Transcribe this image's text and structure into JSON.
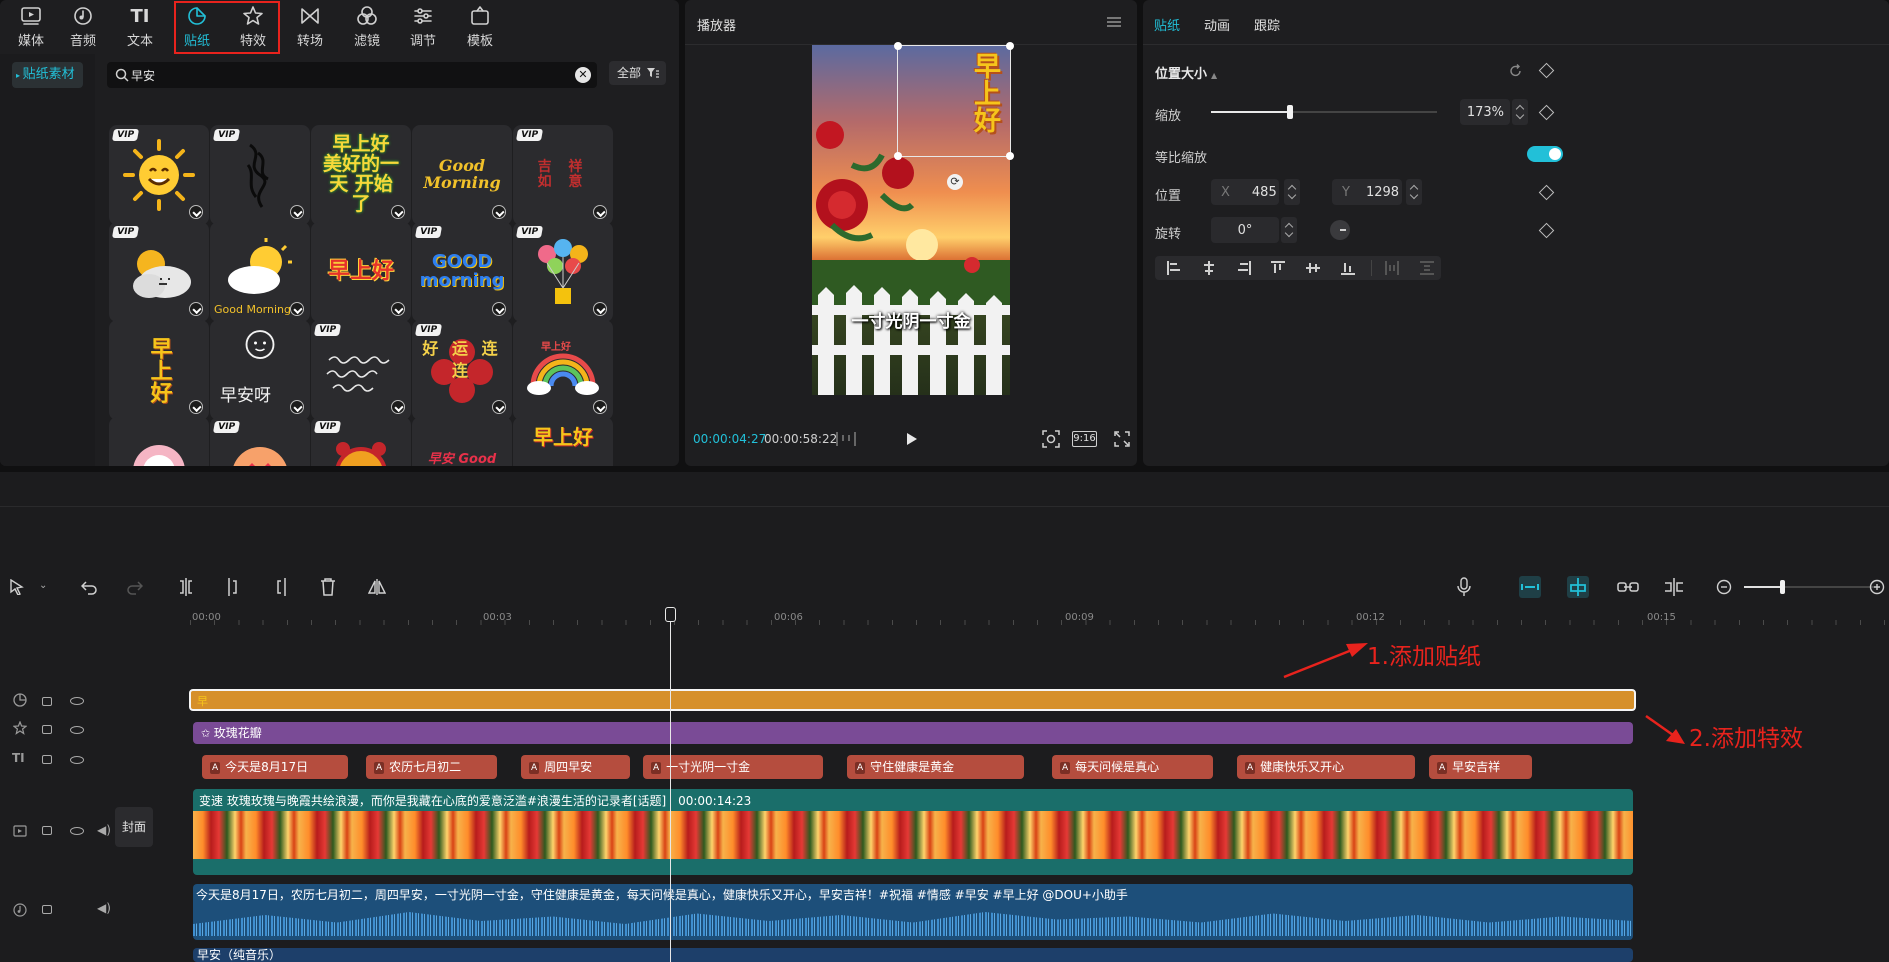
{
  "toolbar": {
    "items": [
      {
        "label": "媒体",
        "icon": "media-icon"
      },
      {
        "label": "音频",
        "icon": "audio-icon"
      },
      {
        "label": "文本",
        "icon": "text-icon",
        "glyph": "TI"
      },
      {
        "label": "贴纸",
        "icon": "sticker-icon",
        "active": true
      },
      {
        "label": "特效",
        "icon": "effects-icon"
      },
      {
        "label": "转场",
        "icon": "transition-icon"
      },
      {
        "label": "滤镜",
        "icon": "filter-icon"
      },
      {
        "label": "调节",
        "icon": "adjust-icon"
      },
      {
        "label": "模板",
        "icon": "template-icon"
      }
    ]
  },
  "sidebar": {
    "active_item": "贴纸素材"
  },
  "search": {
    "value": "早安",
    "filter_label": "全部"
  },
  "stickers": [
    {
      "vip": "VIP",
      "desc": "sun-face"
    },
    {
      "vip": "VIP",
      "desc": "black-brush"
    },
    {
      "vip": "",
      "text": "早上好 美好的一天 开始了"
    },
    {
      "vip": "",
      "text": "Good Morning"
    },
    {
      "vip": "VIP",
      "text": "吉 祥 如 意"
    },
    {
      "vip": "VIP",
      "desc": "cloud-sun"
    },
    {
      "vip": "",
      "text": "Good Morning",
      "desc": "cloud-sun-2"
    },
    {
      "vip": "",
      "text": "早上好"
    },
    {
      "vip": "VIP",
      "text": "GOOD morning"
    },
    {
      "vip": "VIP",
      "desc": "balloons"
    },
    {
      "vip": "",
      "text": "早上好"
    },
    {
      "vip": "",
      "text": "早安呀"
    },
    {
      "vip": "VIP",
      "desc": "handwriting"
    },
    {
      "vip": "VIP",
      "text": "好 运 连 连"
    },
    {
      "vip": "",
      "text": "早上好",
      "desc": "rainbow"
    },
    {
      "vip": "",
      "desc": "pink-flower"
    },
    {
      "vip": "VIP",
      "desc": "love-face"
    },
    {
      "vip": "VIP",
      "desc": "alarm-clock"
    },
    {
      "vip": "",
      "text": "早安 Good Time"
    },
    {
      "vip": "",
      "text": "早上好"
    }
  ],
  "player": {
    "title": "播放器",
    "preview_sticker_text": "早上好",
    "subtitle": "一寸光阴一寸金",
    "current_time": "00:00:04:27",
    "total_time": "00:00:58:22",
    "ratio": "9:16"
  },
  "properties": {
    "tabs": [
      "贴纸",
      "动画",
      "跟踪"
    ],
    "section_title": "位置大小",
    "scale_label": "缩放",
    "scale_value": "173%",
    "scale_fraction": 0.35,
    "uniform_label": "等比缩放",
    "uniform_on": true,
    "position_label": "位置",
    "x_label": "X",
    "x_value": "485",
    "y_label": "Y",
    "y_value": "1298",
    "rotate_label": "旋转",
    "rotate_value": "0°"
  },
  "timeline": {
    "ruler": [
      "00:00",
      "00:03",
      "00:06",
      "00:09",
      "00:12",
      "00:15"
    ],
    "effect_clip": "玫瑰花瓣",
    "text_clips": [
      "今天是8月17日",
      "农历七月初二",
      "周四早安",
      "一寸光阴一寸金",
      "守住健康是黄金",
      "每天问候是真心",
      "健康快乐又开心",
      "早安吉祥"
    ],
    "cover_label": "封面",
    "video_clip_title": "变速  玫瑰玫瑰与晚霞共绘浪漫，而你是我藏在心底的爱意泛滥#浪漫生活的记录者[话题]",
    "video_clip_duration": "00:00:14:23",
    "audio_clip_title": "今天是8月17日，农历七月初二，周四早安，一寸光阴一寸金，守住健康是黄金，每天问候是真心，健康快乐又开心，早安吉祥！#祝福 #情感 #早安 #早上好 @DOU+小助手",
    "music_clip_title": "早安（纯音乐）"
  },
  "annotations": {
    "step1": "1.添加贴纸",
    "step2": "2.添加特效",
    "color": "#e8231d"
  },
  "colors": {
    "accent": "#22c0d8",
    "sticker_track": "#d6902a",
    "effect_track": "#7a4b96",
    "text_track": "#b54d3e",
    "video_track": "#1a6e6a",
    "audio_track": "#1d4f7a"
  }
}
